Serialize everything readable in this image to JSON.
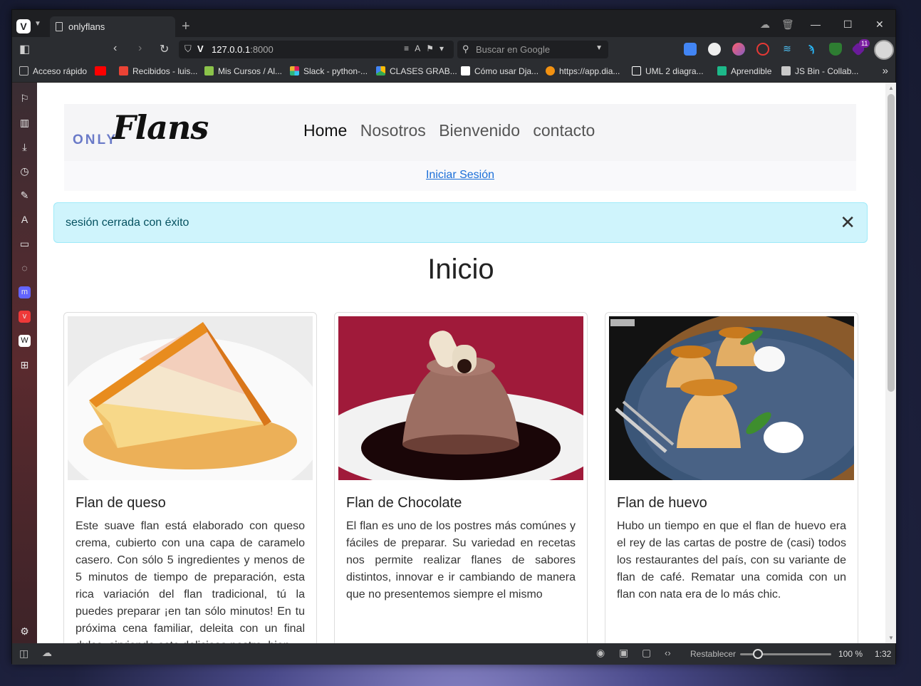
{
  "browser": {
    "tab_title": "onlyflans",
    "url_host": "127.0.0.1",
    "url_port": ":8000",
    "search_placeholder": "Buscar en Google",
    "extension_badge": "11",
    "bookmarks": [
      {
        "label": "Acceso rápido",
        "color": "#9aa0a6"
      },
      {
        "label": "",
        "color": "#ff0000"
      },
      {
        "label": "Recibidos - luis...",
        "color": "#ea4335"
      },
      {
        "label": "Mis Cursos / Al...",
        "color": "#8bc34a"
      },
      {
        "label": "Slack - python-...",
        "color": "#e01e5a"
      },
      {
        "label": "CLASES GRAB...",
        "color": "#fbbc04"
      },
      {
        "label": "Cómo usar Dja...",
        "color": "#ffffff"
      },
      {
        "label": "https://app.dia...",
        "color": "#f29111"
      },
      {
        "label": "UML 2 diagra...",
        "color": "#ffffff"
      },
      {
        "label": "Aprendible",
        "color": "#1db98a"
      },
      {
        "label": "JS Bin - Collab...",
        "color": "#c9c9c9"
      }
    ],
    "status": {
      "reset_label": "Restablecer",
      "zoom": "100 %",
      "zoom_fraction": 0.2,
      "clock": "1:32"
    }
  },
  "site": {
    "logo_only": "ONLY",
    "logo_flans": "Flans",
    "nav": [
      "Home",
      "Nosotros",
      "Bienvenido",
      "contacto"
    ],
    "login_link": "Iniciar Sesión",
    "alert_message": "sesión cerrada con éxito",
    "alert_close": "✕",
    "page_title": "Inicio",
    "cards": [
      {
        "title": "Flan de queso",
        "text": "Este suave flan está elaborado con queso crema, cubierto con una capa de caramelo casero. Con sólo 5 ingredientes y menos de 5 minutos de tiempo de preparación, esta rica variación del flan tradicional, tú la puedes preparar ¡en tan sólo minutos! En tu próxima cena familiar, deleita con un final dulce, sirviendo este delicioso postre, bien"
      },
      {
        "title": "Flan de Chocolate",
        "text": "El flan es uno de los postres más comúnes y fáciles de preparar. Su variedad en recetas nos permite realizar flanes de sabores distintos, innovar e ir cambiando de manera que no presentemos siempre el mismo"
      },
      {
        "title": "Flan de huevo",
        "text": "Hubo un tiempo en que el flan de huevo era el rey de las cartas de postre de (casi) todos los restaurantes del país, con su variante de flan de café. Rematar una comida con un flan con nata era de lo más chic."
      }
    ]
  }
}
